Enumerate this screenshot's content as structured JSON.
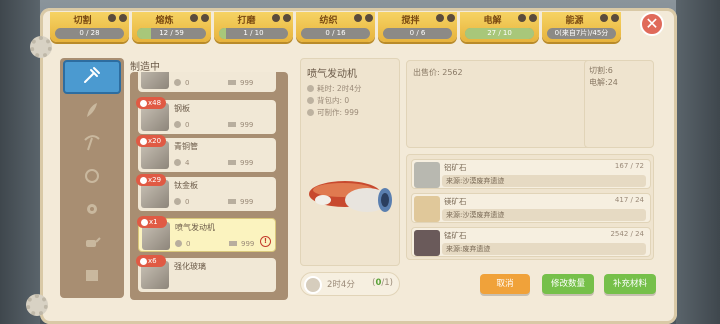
{
  "resource_tabs": [
    {
      "label": "切割",
      "value": "0 / 28",
      "fill": 0.0
    },
    {
      "label": "熔炼",
      "value": "12 / 59",
      "fill": 0.2
    },
    {
      "label": "打磨",
      "value": "1 / 10",
      "fill": 0.1
    },
    {
      "label": "纺织",
      "value": "0 / 16",
      "fill": 0.0
    },
    {
      "label": "搅拌",
      "value": "0 / 6",
      "fill": 0.0
    },
    {
      "label": "电解",
      "value": "27 / 10",
      "fill": 1.0
    },
    {
      "label": "能源",
      "value": "0(来自7片)/45分",
      "fill": 0.0
    }
  ],
  "section_title": "制造中",
  "categories": [
    "tools-icon",
    "feather-icon",
    "pickaxe-icon",
    "seed-icon",
    "gear-icon",
    "watering-can-icon",
    "crate-icon"
  ],
  "craft_items": [
    {
      "name": "",
      "badge": "",
      "backpack": "0",
      "price": "999"
    },
    {
      "name": "钢板",
      "badge": "x48",
      "backpack": "0",
      "price": "999"
    },
    {
      "name": "青铜管",
      "badge": "x20",
      "backpack": "4",
      "price": "999"
    },
    {
      "name": "钛金板",
      "badge": "x29",
      "backpack": "0",
      "price": "999"
    },
    {
      "name": "喷气发动机",
      "badge": "x1",
      "backpack": "0",
      "price": "999",
      "selected": true
    },
    {
      "name": "强化玻璃",
      "badge": "x6",
      "backpack": "",
      "price": ""
    }
  ],
  "detail": {
    "name": "喷气发动机",
    "time_label": "耗时:",
    "time_value": "2时4分",
    "backpack_label": "背包内:",
    "backpack_value": "0",
    "craftable_label": "可制作:",
    "craftable_value": "999"
  },
  "sale": {
    "label": "出售价:",
    "value": "2562"
  },
  "stats": {
    "cut": "切割:6",
    "electrolysis": "电解:24"
  },
  "materials": [
    {
      "name": "铝矿石",
      "count": "167 / 72",
      "source": "来源:沙漠废弃遗迹",
      "color": "#b8b8b0"
    },
    {
      "name": "镁矿石",
      "count": "417 / 24",
      "source": "来源:沙漠废弃遗迹",
      "color": "#e0c89a"
    },
    {
      "name": "锰矿石",
      "count": "2542 / 24",
      "source": "来源:废弃遗迹",
      "color": "#6a5a5a"
    }
  ],
  "timer": {
    "time": "2时4分",
    "count_open": "(",
    "count_done": "0",
    "count_rest": "/1)"
  },
  "buttons": {
    "cancel": "取消",
    "modify": "修改数量",
    "supply": "补充材料"
  },
  "colors": {
    "accent": "#f0a23a",
    "green": "#76c04a",
    "tab_gold": "#f6d364",
    "selected_blue": "#4b9ad0"
  }
}
